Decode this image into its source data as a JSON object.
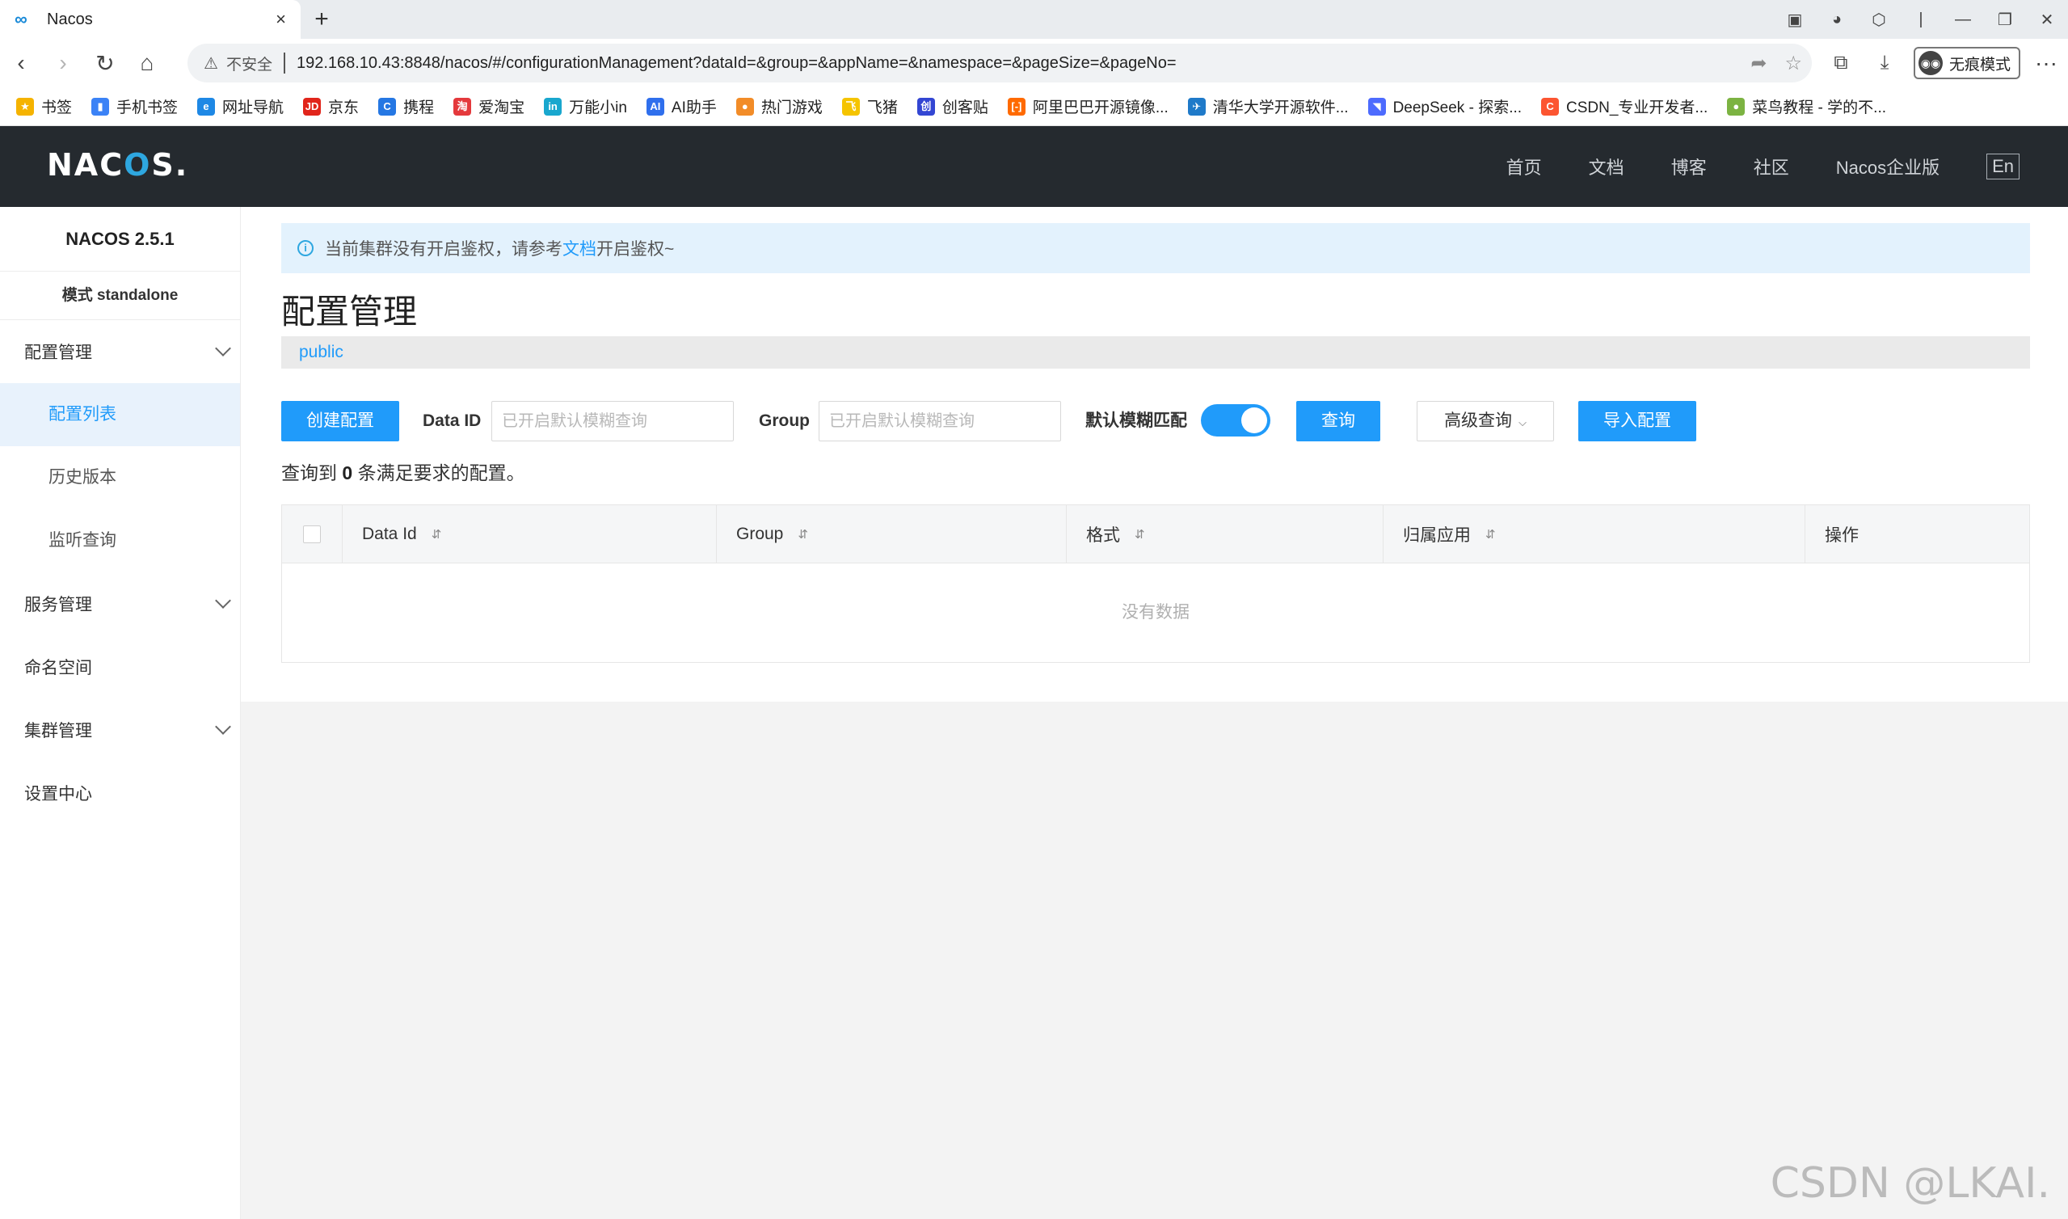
{
  "browser": {
    "tab_title": "Nacos",
    "tab_close": "×",
    "new_tab": "+",
    "insecure_label": "不安全",
    "url": "192.168.10.43:8848/nacos/#/configurationManagement?dataId=&group=&appName=&namespace=&pageSize=&pageNo=",
    "incognito_label": "无痕模式",
    "more": "···",
    "window_controls": [
      "—",
      "❐",
      "✕"
    ]
  },
  "bookmarks": [
    {
      "label": "书签",
      "icon": "star-icon",
      "color": "#f5b300",
      "glyph": "★"
    },
    {
      "label": "手机书签",
      "icon": "phone-icon",
      "color": "#3b82f6",
      "glyph": "▮"
    },
    {
      "label": "网址导航",
      "icon": "nav-icon",
      "color": "#1e88e5",
      "glyph": "e"
    },
    {
      "label": "京东",
      "icon": "jd-icon",
      "color": "#e1251b",
      "glyph": "JD"
    },
    {
      "label": "携程",
      "icon": "ctrip-icon",
      "color": "#2577e3",
      "glyph": "C"
    },
    {
      "label": "爱淘宝",
      "icon": "taobao-icon",
      "color": "#e4393c",
      "glyph": "淘"
    },
    {
      "label": "万能小in",
      "icon": "wanneng-icon",
      "color": "#19a7ce",
      "glyph": "in"
    },
    {
      "label": "AI助手",
      "icon": "ai-icon",
      "color": "#2f6fed",
      "glyph": "AI"
    },
    {
      "label": "热门游戏",
      "icon": "game-icon",
      "color": "#f28c28",
      "glyph": "●"
    },
    {
      "label": "飞猪",
      "icon": "fliggy-icon",
      "color": "#f5c400",
      "glyph": "飞"
    },
    {
      "label": "创客贴",
      "icon": "chuangke-icon",
      "color": "#3346d3",
      "glyph": "创"
    },
    {
      "label": "阿里巴巴开源镜像...",
      "icon": "aliyun-icon",
      "color": "#ff6a00",
      "glyph": "[-]"
    },
    {
      "label": "清华大学开源软件...",
      "icon": "tuna-icon",
      "color": "#1f7ac9",
      "glyph": "✈"
    },
    {
      "label": "DeepSeek - 探索...",
      "icon": "deepseek-icon",
      "color": "#4d6bfe",
      "glyph": "◥"
    },
    {
      "label": "CSDN_专业开发者...",
      "icon": "csdn-icon",
      "color": "#fc5531",
      "glyph": "C"
    },
    {
      "label": "菜鸟教程 - 学的不...",
      "icon": "runoob-icon",
      "color": "#7cb342",
      "glyph": "●"
    }
  ],
  "header": {
    "logo_parts": [
      "NAC",
      "O",
      "S."
    ],
    "nav": [
      "首页",
      "文档",
      "博客",
      "社区",
      "Nacos企业版"
    ],
    "lang": "En"
  },
  "sidebar": {
    "version": "NACOS 2.5.1",
    "mode": "模式 standalone",
    "groups": [
      {
        "label": "配置管理",
        "items": [
          "配置列表",
          "历史版本",
          "监听查询"
        ]
      },
      {
        "label": "服务管理"
      },
      {
        "label": "命名空间"
      },
      {
        "label": "集群管理"
      },
      {
        "label": "设置中心"
      }
    ],
    "active_item": "配置列表"
  },
  "notice": {
    "prefix": "当前集群没有开启鉴权，请参考",
    "link": "文档",
    "suffix": "开启鉴权~"
  },
  "page": {
    "title": "配置管理",
    "namespace": "public"
  },
  "filters": {
    "create_button": "创建配置",
    "data_id_label": "Data ID",
    "data_id_placeholder": "已开启默认模糊查询",
    "group_label": "Group",
    "group_placeholder": "已开启默认模糊查询",
    "fuzzy_label": "默认模糊匹配",
    "fuzzy_enabled": true,
    "query_button": "查询",
    "advanced_button": "高级查询",
    "import_button": "导入配置"
  },
  "result": {
    "prefix": "查询到 ",
    "count": "0",
    "suffix": " 条满足要求的配置。"
  },
  "table": {
    "columns": [
      "Data Id",
      "Group",
      "格式",
      "归属应用",
      "操作"
    ],
    "empty_text": "没有数据"
  },
  "watermark": "CSDN @LKAI."
}
